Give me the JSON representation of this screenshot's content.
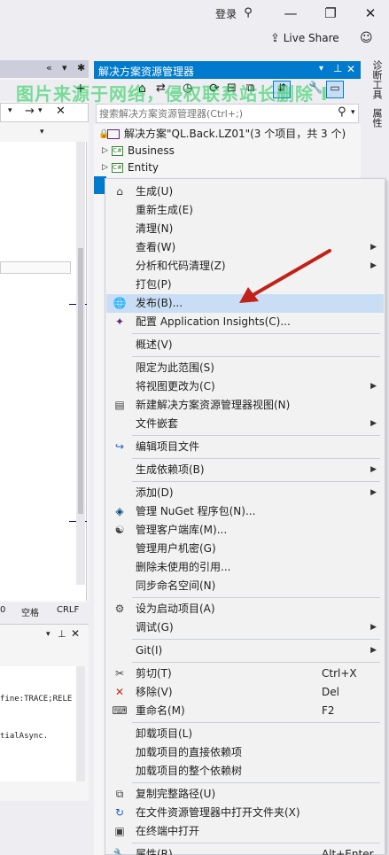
{
  "titlebar": {
    "login": "登录",
    "minimize": "—",
    "restore": "❐",
    "close": "✕"
  },
  "liveshare": {
    "label": "Live Share"
  },
  "editor": {
    "status": {
      "col": "0",
      "space": "空格",
      "eol": "CRLF"
    },
    "output_lines": [
      "fine:TRACE;RELE",
      "tialAsync."
    ]
  },
  "solution_explorer": {
    "title": "解决方案资源管理器",
    "search_placeholder": "搜索解决方案资源管理器(Ctrl+;)",
    "solution_label": "解决方案\"QL.Back.LZ01\"(3 个项目，共 3 个)",
    "projects": [
      {
        "name": "Business",
        "icon": "C#"
      },
      {
        "name": "Entity",
        "icon": "C#"
      }
    ]
  },
  "side_tabs": [
    "诊断工具",
    "属性"
  ],
  "watermark": "图片来源于网络，侵权联系站长删除 I",
  "context_menu": {
    "items": [
      {
        "label": "生成(U)",
        "icon": "build-icon"
      },
      {
        "label": "重新生成(E)"
      },
      {
        "label": "清理(N)"
      },
      {
        "label": "查看(W)",
        "submenu": true
      },
      {
        "label": "分析和代码清理(Z)",
        "submenu": true
      },
      {
        "label": "打包(P)"
      },
      {
        "label": "发布(B)...",
        "icon": "globe-icon",
        "highlighted": true
      },
      {
        "label": "配置 Application Insights(C)...",
        "icon": "insights-icon"
      },
      {
        "sep": true
      },
      {
        "label": "概述(V)"
      },
      {
        "sep": true
      },
      {
        "label": "限定为此范围(S)"
      },
      {
        "label": "将视图更改为(C)",
        "submenu": true
      },
      {
        "label": "新建解决方案资源管理器视图(N)",
        "icon": "new-view-icon"
      },
      {
        "label": "文件嵌套",
        "submenu": true
      },
      {
        "sep": true
      },
      {
        "label": "编辑项目文件",
        "icon": "edit-icon"
      },
      {
        "sep": true
      },
      {
        "label": "生成依赖项(B)",
        "submenu": true
      },
      {
        "sep": true
      },
      {
        "label": "添加(D)",
        "submenu": true
      },
      {
        "label": "管理 NuGet 程序包(N)...",
        "icon": "nuget-icon"
      },
      {
        "label": "管理客户端库(M)...",
        "icon": "library-icon"
      },
      {
        "label": "管理用户机密(G)"
      },
      {
        "label": "删除未使用的引用..."
      },
      {
        "label": "同步命名空间(N)"
      },
      {
        "sep": true
      },
      {
        "label": "设为启动项目(A)",
        "icon": "gear-icon"
      },
      {
        "label": "调试(G)",
        "submenu": true
      },
      {
        "sep": true
      },
      {
        "label": "Git(I)",
        "submenu": true
      },
      {
        "sep": true
      },
      {
        "label": "剪切(T)",
        "icon": "cut-icon",
        "shortcut": "Ctrl+X"
      },
      {
        "label": "移除(V)",
        "icon": "remove-icon",
        "shortcut": "Del"
      },
      {
        "label": "重命名(M)",
        "icon": "rename-icon",
        "shortcut": "F2"
      },
      {
        "sep": true
      },
      {
        "label": "卸载项目(L)"
      },
      {
        "label": "加载项目的直接依赖项"
      },
      {
        "label": "加载项目的整个依赖树"
      },
      {
        "sep": true
      },
      {
        "label": "复制完整路径(U)",
        "icon": "copy-icon"
      },
      {
        "label": "在文件资源管理器中打开文件夹(X)",
        "icon": "refresh-icon"
      },
      {
        "label": "在终端中打开",
        "icon": "terminal-icon"
      },
      {
        "sep": true
      },
      {
        "label": "属性(R)",
        "icon": "wrench-icon",
        "shortcut": "Alt+Enter"
      }
    ]
  }
}
